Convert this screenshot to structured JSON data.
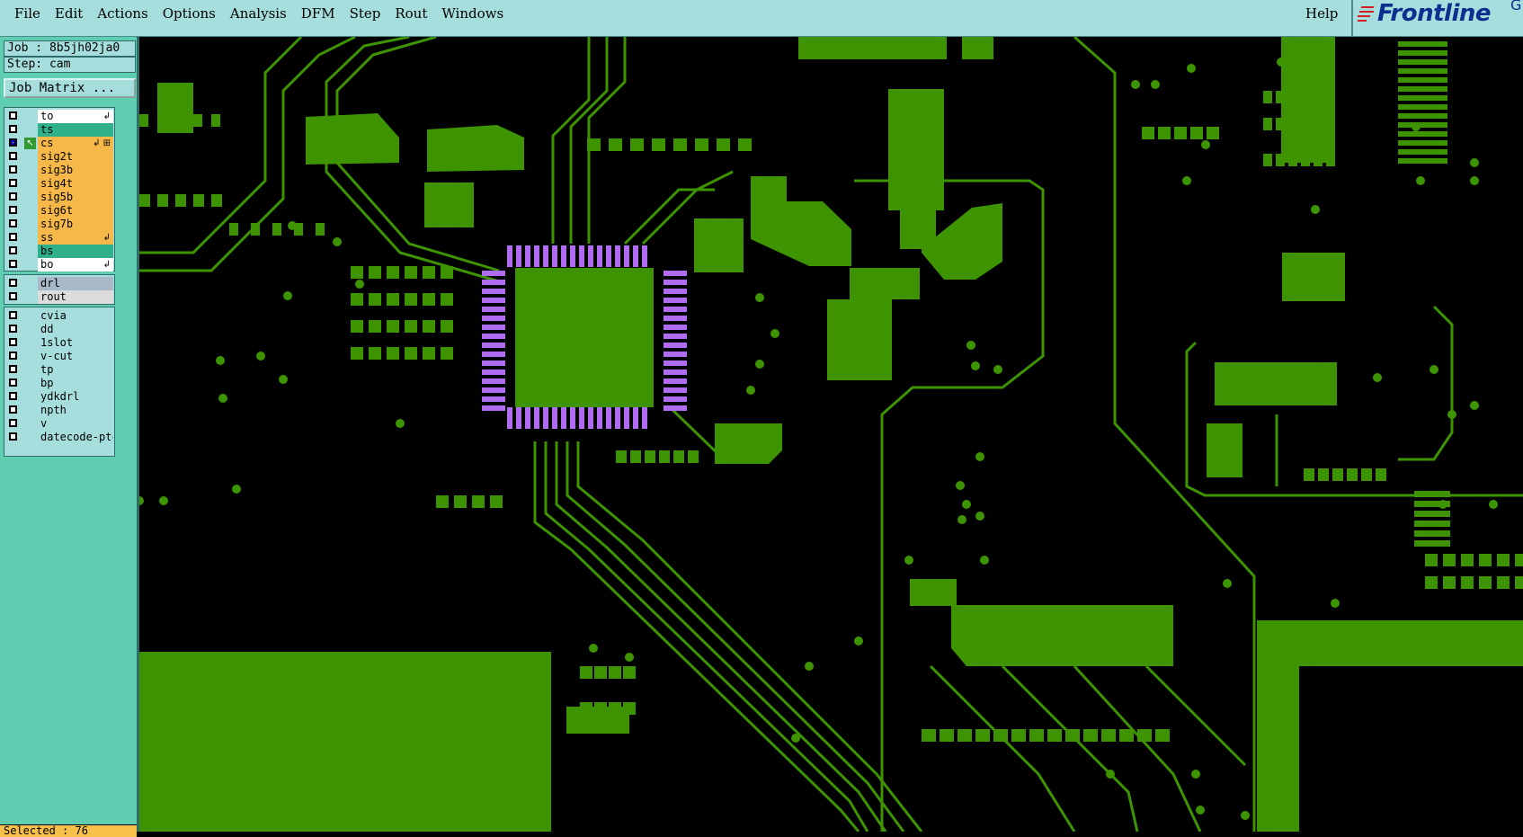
{
  "menubar": {
    "items": [
      "File",
      "Edit",
      "Actions",
      "Options",
      "Analysis",
      "DFM",
      "Step",
      "Rout",
      "Windows"
    ],
    "help": "Help"
  },
  "logo": {
    "text": "Frontline",
    "tail": "G"
  },
  "info": {
    "job": "Job : 8b5jh02ja0",
    "step": "Step: cam"
  },
  "job_matrix_button": "Job Matrix ...",
  "layers_board": [
    {
      "name": "to",
      "color": "#ffffff",
      "mark": "↲"
    },
    {
      "name": "ts",
      "color": "#2fb08a",
      "mark": ""
    },
    {
      "name": "cs",
      "color": "#f7b84a",
      "mark": "↲ ⊞",
      "affected": true,
      "active": true
    },
    {
      "name": "sig2t",
      "color": "#f7b84a",
      "mark": ""
    },
    {
      "name": "sig3b",
      "color": "#f7b84a",
      "mark": ""
    },
    {
      "name": "sig4t",
      "color": "#f7b84a",
      "mark": ""
    },
    {
      "name": "sig5b",
      "color": "#f7b84a",
      "mark": ""
    },
    {
      "name": "sig6t",
      "color": "#f7b84a",
      "mark": ""
    },
    {
      "name": "sig7b",
      "color": "#f7b84a",
      "mark": ""
    },
    {
      "name": "ss",
      "color": "#f7b84a",
      "mark": "↲"
    },
    {
      "name": "bs",
      "color": "#2fb08a",
      "mark": ""
    },
    {
      "name": "bo",
      "color": "#ffffff",
      "mark": "↲"
    }
  ],
  "layers_drill": [
    {
      "name": "drl",
      "color": "#a7b9c7"
    },
    {
      "name": "rout",
      "color": "#dcdcdc"
    }
  ],
  "layers_misc": [
    {
      "name": "cvia",
      "color": "#a6dede"
    },
    {
      "name": "dd",
      "color": "#a6dede"
    },
    {
      "name": "1slot",
      "color": "#a6dede"
    },
    {
      "name": "v-cut",
      "color": "#a6dede"
    },
    {
      "name": "tp",
      "color": "#a6dede"
    },
    {
      "name": "bp",
      "color": "#a6dede"
    },
    {
      "name": "ydkdrl",
      "color": "#a6dede"
    },
    {
      "name": "npth",
      "color": "#a6dede"
    },
    {
      "name": "v",
      "color": "#a6dede"
    },
    {
      "name": "datecode-ptc",
      "color": "#a6dede"
    }
  ],
  "selected": "Selected : 76",
  "colors": {
    "copper": "#3d9400",
    "pads": "#b06cf0",
    "background": "#000000"
  }
}
